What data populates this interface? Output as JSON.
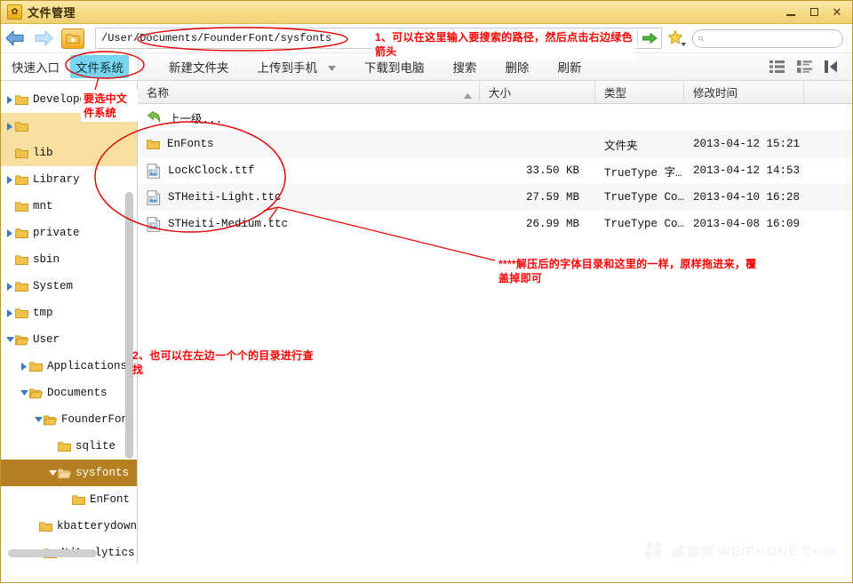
{
  "window": {
    "title": "文件管理",
    "icon": "app-icon",
    "minimize": "–",
    "maximize": "□",
    "close": "✕"
  },
  "nav": {
    "back": "back-arrow",
    "forward": "forward-arrow",
    "up": "up-folder",
    "address_value": "/User/Documents/FounderFont/sysfonts",
    "address_placeholder": "",
    "dropdown": "▾",
    "go": "→",
    "favorite": "★",
    "search_value": "",
    "search_placeholder": ""
  },
  "tabs": [
    {
      "label": "快速入口",
      "active": false
    },
    {
      "label": "文件系统",
      "active": true
    }
  ],
  "toolbar": {
    "buttons": [
      {
        "label": "新建文件夹",
        "has_caret": false
      },
      {
        "label": "上传到手机",
        "has_caret": true
      },
      {
        "label": "下载到电脑",
        "has_caret": false
      },
      {
        "label": "搜索",
        "has_caret": false
      },
      {
        "label": "删除",
        "has_caret": false
      },
      {
        "label": "刷新",
        "has_caret": false
      }
    ],
    "view_icons": [
      "list-view-icon",
      "detail-view-icon",
      "collapse-panel-icon"
    ]
  },
  "sidebar": {
    "items": [
      {
        "label": "Developer",
        "indent": 0,
        "twisty": "collapsed",
        "highlight": "none"
      },
      {
        "label": "",
        "indent": 0,
        "twisty": "collapsed",
        "highlight": "yellow"
      },
      {
        "label": "lib",
        "indent": 0,
        "twisty": "none",
        "highlight": "yellow"
      },
      {
        "label": "Library",
        "indent": 0,
        "twisty": "collapsed",
        "highlight": "none"
      },
      {
        "label": "mnt",
        "indent": 0,
        "twisty": "none",
        "highlight": "none"
      },
      {
        "label": "private",
        "indent": 0,
        "twisty": "collapsed",
        "highlight": "none"
      },
      {
        "label": "sbin",
        "indent": 0,
        "twisty": "none",
        "highlight": "none"
      },
      {
        "label": "System",
        "indent": 0,
        "twisty": "collapsed",
        "highlight": "none"
      },
      {
        "label": "tmp",
        "indent": 0,
        "twisty": "collapsed",
        "highlight": "none"
      },
      {
        "label": "User",
        "indent": 0,
        "twisty": "expanded",
        "highlight": "none"
      },
      {
        "label": "Applications",
        "indent": 1,
        "twisty": "collapsed",
        "highlight": "none"
      },
      {
        "label": "Documents",
        "indent": 1,
        "twisty": "expanded",
        "highlight": "none"
      },
      {
        "label": "FounderFont",
        "indent": 2,
        "twisty": "expanded",
        "highlight": "none"
      },
      {
        "label": "sqlite",
        "indent": 3,
        "twisty": "none",
        "highlight": "none"
      },
      {
        "label": "sysfonts",
        "indent": 3,
        "twisty": "expanded",
        "highlight": "selected"
      },
      {
        "label": "EnFont",
        "indent": 4,
        "twisty": "none",
        "highlight": "none"
      },
      {
        "label": "kbatterydown",
        "indent": 2,
        "twisty": "none",
        "highlight": "none"
      },
      {
        "label": "NdAnalytics",
        "indent": 2,
        "twisty": "none",
        "highlight": "none"
      }
    ]
  },
  "filelist": {
    "columns": [
      "名称",
      "大小",
      "类型",
      "修改时间"
    ],
    "sort_indicator": "▲",
    "parent_row": {
      "name": "上一级...",
      "icon": "back-up-icon"
    },
    "rows": [
      {
        "name": "EnFonts",
        "icon": "folder-icon",
        "size": "",
        "type": "文件夹",
        "time": "2013-04-12 15:21"
      },
      {
        "name": "LockClock.ttf",
        "icon": "font-file-icon",
        "size": "33.50 KB",
        "type": "TrueType 字…",
        "time": "2013-04-12 14:53"
      },
      {
        "name": "STHeiti-Light.ttc",
        "icon": "font-file-icon",
        "size": "27.59 MB",
        "type": "TrueType Co…",
        "time": "2013-04-10 16:28"
      },
      {
        "name": "STHeiti-Medium.ttc",
        "icon": "font-file-icon",
        "size": "26.99 MB",
        "type": "TrueType Co…",
        "time": "2013-04-08 16:09"
      }
    ]
  },
  "annotations": {
    "a1": "1、可以在这里输入要搜索的路径，然后点击右边绿色箭头",
    "a2": "要选中文件系统",
    "a3": "2、也可以在左边一个个的目录进行查找",
    "a4": "****解压后的字体目录和这里的一样，原样拖进来，覆盖掉即可"
  },
  "watermark": {
    "text": "WEIPHONE.COM",
    "cn": "威锋网"
  },
  "colors": {
    "title_bar": "#f5dd8c",
    "tab_active": "#79d5ef",
    "tree_selected": "#b5801f",
    "tree_highlight": "#f6dfa0",
    "annotation": "#ff0000",
    "go_arrow": "#4fb43a",
    "folder": "#f0c34a"
  }
}
